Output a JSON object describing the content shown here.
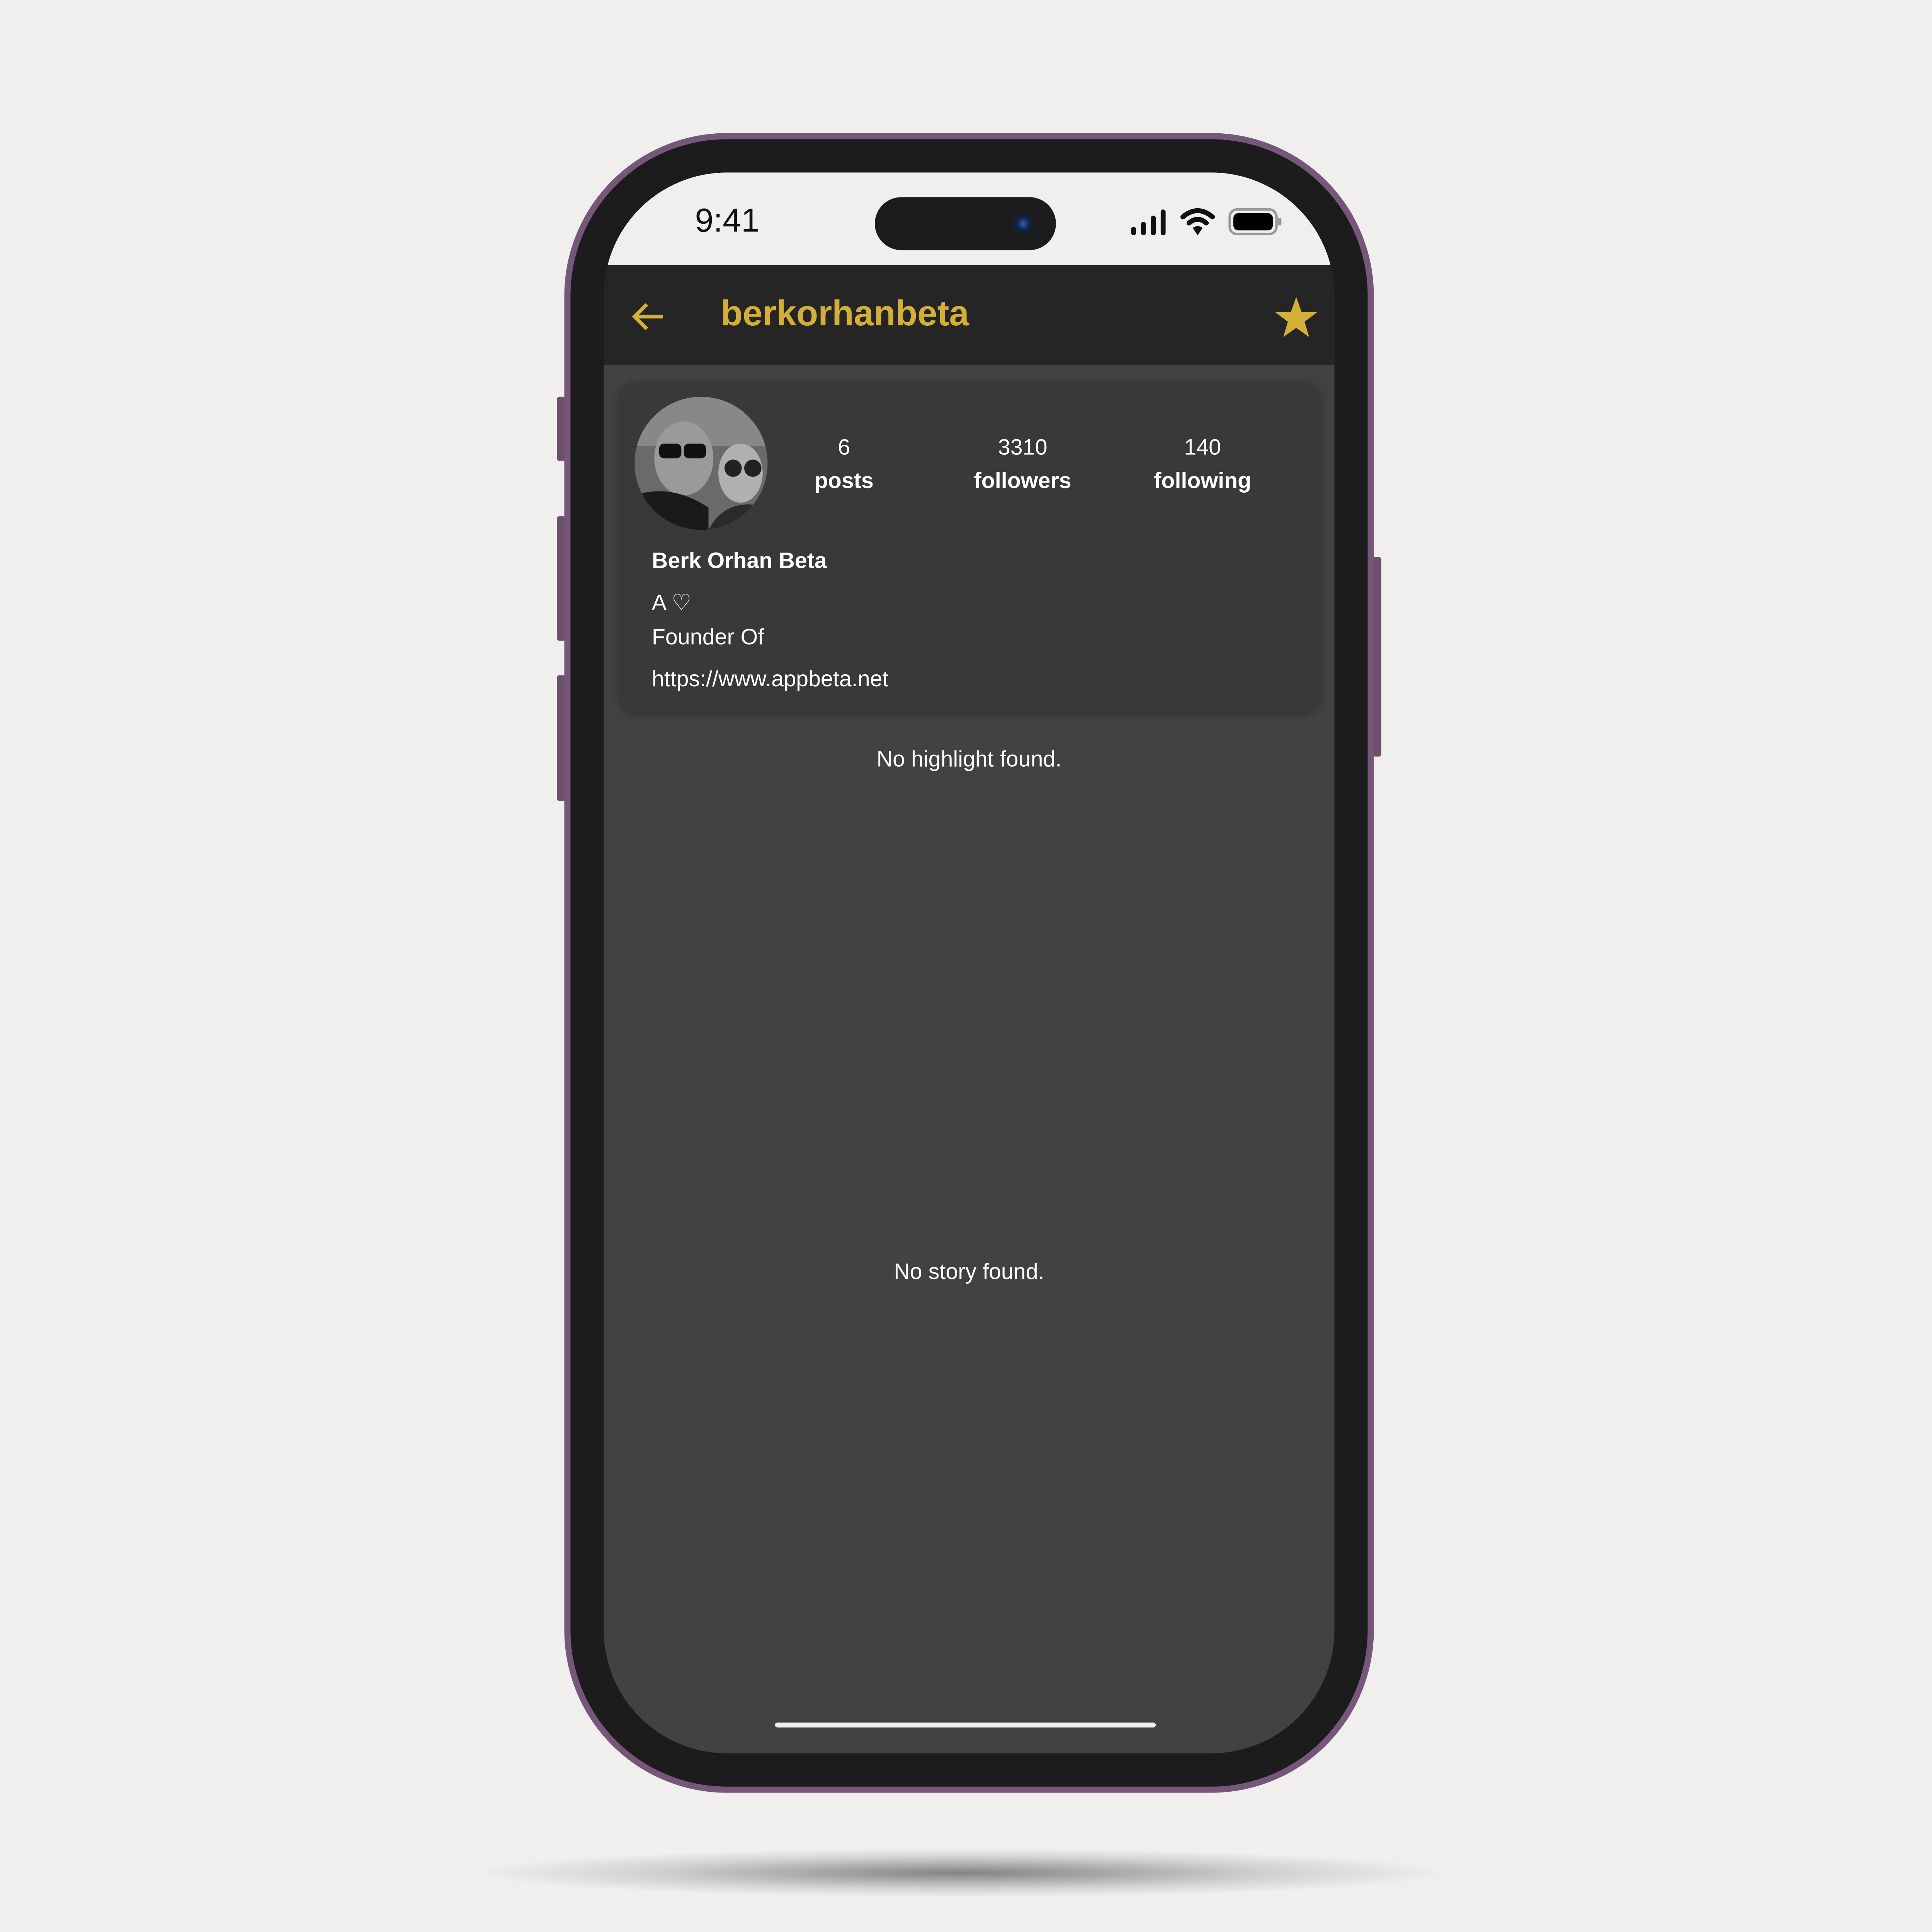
{
  "status_bar": {
    "time": "9:41",
    "icons": [
      "signal-icon",
      "wifi-icon",
      "battery-icon"
    ]
  },
  "app_bar": {
    "title": "berkorhanbeta",
    "back_icon": "arrow-left-icon",
    "favorite_icon": "star-icon",
    "accent_color": "#d4af37"
  },
  "profile": {
    "stats": [
      {
        "value": "6",
        "label": "posts"
      },
      {
        "value": "3310",
        "label": "followers"
      },
      {
        "value": "140",
        "label": "following"
      }
    ],
    "name": "Berk Orhan Beta",
    "bio_line1": "A ♡",
    "bio_line2": "Founder Of",
    "website": "https://www.appbeta.net"
  },
  "highlights": {
    "empty_text": "No highlight found."
  },
  "stories": {
    "empty_text": "No story found."
  }
}
